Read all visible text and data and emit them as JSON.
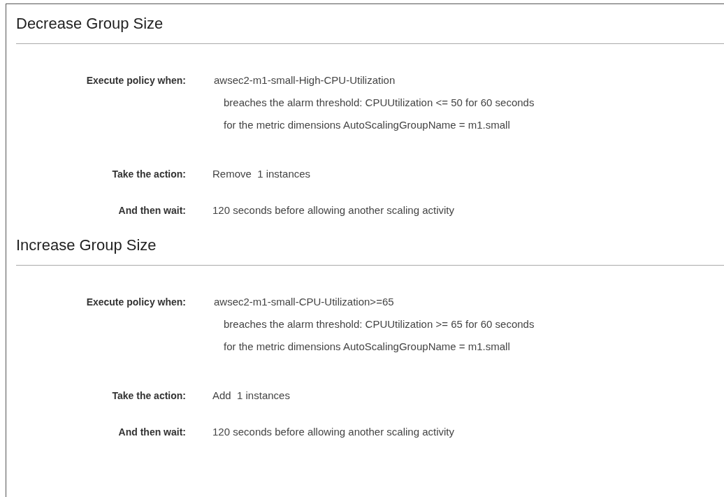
{
  "sections": [
    {
      "heading": "Decrease Group Size",
      "rows": [
        {
          "label": "Execute policy when:",
          "value": "awsec2-m1-small-High-CPU-Utilization",
          "details": [
            "breaches the alarm threshold: CPUUtilization <= 50 for 60 seconds",
            "for the metric dimensions AutoScalingGroupName = m1.small"
          ]
        },
        {
          "label": "Take the action:",
          "value": "Remove  1 instances"
        },
        {
          "label": "And then wait:",
          "value": "120 seconds before allowing another scaling activity"
        }
      ]
    },
    {
      "heading": "Increase Group Size",
      "rows": [
        {
          "label": "Execute policy when:",
          "value": "awsec2-m1-small-CPU-Utilization>=65",
          "details": [
            "breaches the alarm threshold: CPUUtilization >= 65 for 60 seconds",
            "for the metric dimensions AutoScalingGroupName = m1.small"
          ]
        },
        {
          "label": "Take the action:",
          "value": "Add  1 instances"
        },
        {
          "label": "And then wait:",
          "value": "120 seconds before allowing another scaling activity"
        }
      ]
    }
  ]
}
